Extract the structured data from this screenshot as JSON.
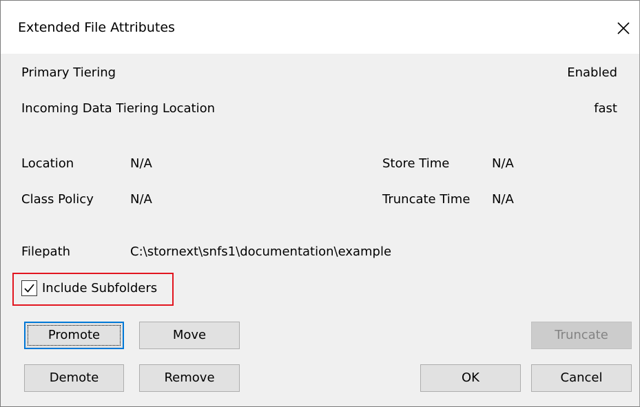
{
  "dialog": {
    "title": "Extended File Attributes",
    "close_glyph": "✕"
  },
  "tiering": {
    "primary_label": "Primary Tiering",
    "primary_value": "Enabled",
    "incoming_label": "Incoming Data Tiering Location",
    "incoming_value": "fast"
  },
  "info": {
    "location_label": "Location",
    "location_value": "N/A",
    "store_time_label": "Store Time",
    "store_time_value": "N/A",
    "class_policy_label": "Class Policy",
    "class_policy_value": "N/A",
    "truncate_time_label": "Truncate Time",
    "truncate_time_value": "N/A",
    "filepath_label": "Filepath",
    "filepath_value": "C:\\stornext\\snfs1\\documentation\\example"
  },
  "options": {
    "include_subfolders_label": "Include Subfolders",
    "include_subfolders_checked": true
  },
  "buttons": {
    "promote": "Promote",
    "move": "Move",
    "truncate": "Truncate",
    "demote": "Demote",
    "remove": "Remove",
    "ok": "OK",
    "cancel": "Cancel"
  },
  "colors": {
    "highlight_border": "#e2151f",
    "default_button_border": "#0078d7"
  },
  "icons": {
    "close": "close-icon",
    "checkbox": "checkmark-icon"
  }
}
